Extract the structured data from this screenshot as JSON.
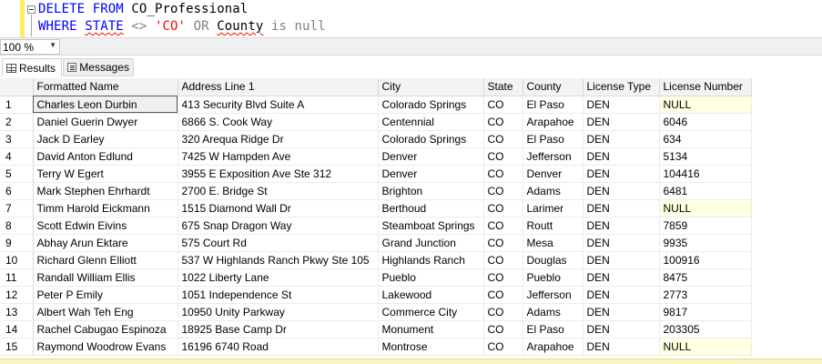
{
  "editor": {
    "line1": {
      "kw1": "DELETE",
      "kw2": "FROM",
      "table": "CO_Professional"
    },
    "line2": {
      "kw1": "WHERE",
      "col1": "STATE",
      "op1": "<>",
      "str1": "'CO'",
      "op2": "OR",
      "col2": "County",
      "op3": "is",
      "op4": "null"
    }
  },
  "zoom": {
    "value": "100 %"
  },
  "tabs": [
    {
      "label": "Results",
      "icon": "grid-icon"
    },
    {
      "label": "Messages",
      "icon": "messages-icon"
    }
  ],
  "grid": {
    "columns": [
      "",
      "Formatted Name",
      "Address Line 1",
      "City",
      "State",
      "County",
      "License Type",
      "License Number"
    ],
    "rows": [
      [
        "1",
        "Charles Leon Durbin",
        "413 Security Blvd Suite A",
        "Colorado Springs",
        "CO",
        "El Paso",
        "DEN",
        "NULL"
      ],
      [
        "2",
        "Daniel Guerin Dwyer",
        "6866 S. Cook Way",
        "Centennial",
        "CO",
        "Arapahoe",
        "DEN",
        "6046"
      ],
      [
        "3",
        "Jack D Earley",
        "320 Arequa Ridge Dr",
        "Colorado Springs",
        "CO",
        "El Paso",
        "DEN",
        "634"
      ],
      [
        "4",
        "David Anton Edlund",
        "7425 W Hampden Ave",
        "Denver",
        "CO",
        "Jefferson",
        "DEN",
        "5134"
      ],
      [
        "5",
        "Terry W Egert",
        "3955 E Exposition Ave Ste 312",
        "Denver",
        "CO",
        "Denver",
        "DEN",
        "104416"
      ],
      [
        "6",
        "Mark Stephen Ehrhardt",
        "2700 E. Bridge St",
        "Brighton",
        "CO",
        "Adams",
        "DEN",
        "6481"
      ],
      [
        "7",
        "Timm Harold Eickmann",
        "1515 Diamond Wall Dr",
        "Berthoud",
        "CO",
        "Larimer",
        "DEN",
        "NULL"
      ],
      [
        "8",
        "Scott Edwin Eivins",
        "675 Snap Dragon Way",
        "Steamboat Springs",
        "CO",
        "Routt",
        "DEN",
        "7859"
      ],
      [
        "9",
        "Abhay Arun Ektare",
        "575 Court Rd",
        "Grand Junction",
        "CO",
        "Mesa",
        "DEN",
        "9935"
      ],
      [
        "10",
        "Richard Glenn Elliott",
        "537 W Highlands Ranch Pkwy Ste 105",
        "Highlands Ranch",
        "CO",
        "Douglas",
        "DEN",
        "100916"
      ],
      [
        "11",
        "Randall William Ellis",
        "1022 Liberty Lane",
        "Pueblo",
        "CO",
        "Pueblo",
        "DEN",
        "8475"
      ],
      [
        "12",
        "Peter P Emily",
        "1051 Independence St",
        "Lakewood",
        "CO",
        "Jefferson",
        "DEN",
        "2773"
      ],
      [
        "13",
        "Albert Wah Teh Eng",
        "10950 Unity Parkway",
        "Commerce City",
        "CO",
        "Adams",
        "DEN",
        "9817"
      ],
      [
        "14",
        "Rachel Cabugao Espinoza",
        "18925 Base Camp Dr",
        "Monument",
        "CO",
        "El Paso",
        "DEN",
        "203305"
      ],
      [
        "15",
        "Raymond Woodrow Evans",
        "16196   6740 Road",
        "Montrose",
        "CO",
        "Arapahoe",
        "DEN",
        "NULL"
      ]
    ]
  },
  "colors": {
    "keyword": "#0000ff",
    "string": "#ff0000",
    "operator": "#808080",
    "null_cell": "#ffffe1",
    "editor_margin": "#ffee62"
  }
}
